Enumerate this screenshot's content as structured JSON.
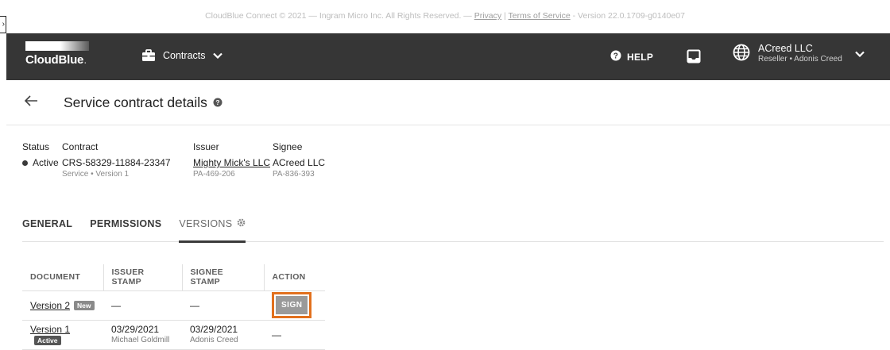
{
  "footer": {
    "copyright": "CloudBlue Connect © 2021 — Ingram Micro Inc. All Rights Reserved. — ",
    "privacy": "Privacy",
    "separator": " | ",
    "terms": "Terms of Service",
    "version": " - Version 22.0.1709-g0140e07"
  },
  "topbar": {
    "logo": "CloudBlue",
    "logo_dot": ".",
    "module_label": "Contracts",
    "help_label": "HELP",
    "account_name": "ACreed LLC",
    "account_sub": "Reseller • Adonis Creed",
    "colors": {
      "background": "#363636"
    }
  },
  "page": {
    "title": "Service contract details"
  },
  "info": {
    "status": {
      "label": "Status",
      "value": "Active"
    },
    "contract": {
      "label": "Contract",
      "value": "CRS-58329-11884-23347",
      "sub": "Service • Version 1"
    },
    "issuer": {
      "label": "Issuer",
      "value": "Mighty Mick's LLC",
      "sub": "PA-469-206"
    },
    "signee": {
      "label": "Signee",
      "value": "ACreed LLC",
      "sub": "PA-836-393"
    }
  },
  "tabs": [
    {
      "label": "GENERAL"
    },
    {
      "label": "PERMISSIONS"
    },
    {
      "label": "VERSIONS"
    }
  ],
  "table": {
    "headers": [
      "DOCUMENT",
      "ISSUER STAMP",
      "SIGNEE STAMP",
      "ACTION"
    ],
    "rows": [
      {
        "document": "Version 2",
        "badge": "New",
        "issuer_stamp": "—",
        "signee_stamp": "—",
        "action": "SIGN"
      },
      {
        "document": "Version 1",
        "badge": "Active",
        "issuer_date": "03/29/2021",
        "issuer_name": "Michael Goldmill",
        "signee_date": "03/29/2021",
        "signee_name": "Adonis Creed",
        "action": "—"
      }
    ]
  },
  "colors": {
    "highlight": "#e2701d"
  }
}
